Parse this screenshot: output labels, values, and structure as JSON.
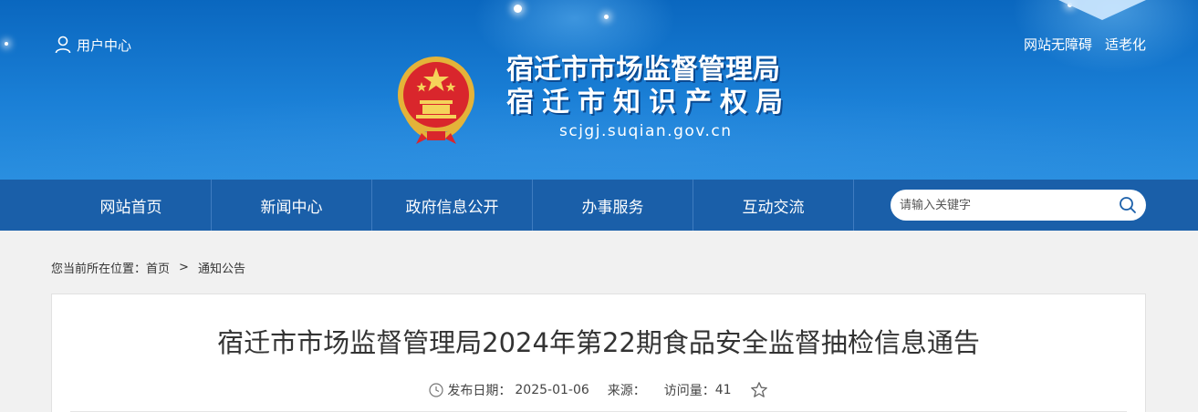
{
  "header": {
    "user_center": "用户中心",
    "accessibility": "网站无障碍",
    "elderly_mode": "适老化",
    "title_line1": "宿迁市市场监督管理局",
    "title_line2": "宿迁市知识产权局",
    "url": "scjgj.suqian.gov.cn",
    "emblem_icon": "national-emblem-icon"
  },
  "nav": {
    "items": [
      {
        "label": "网站首页"
      },
      {
        "label": "新闻中心"
      },
      {
        "label": "政府信息公开"
      },
      {
        "label": "办事服务"
      },
      {
        "label": "互动交流"
      }
    ]
  },
  "search": {
    "placeholder": "请输入关键字",
    "icon": "search-icon"
  },
  "breadcrumb": {
    "prefix": "您当前所在位置：",
    "home": "首页",
    "separator": ">",
    "current": "通知公告"
  },
  "article": {
    "title": "宿迁市市场监督管理局2024年第22期食品安全监督抽检信息通告",
    "publish_label": "发布日期：",
    "publish_date": "2025-01-06",
    "source_label": "来源：",
    "source": "",
    "visits_label": "访问量：",
    "visits": "41",
    "favorite_icon": "star-icon"
  },
  "colors": {
    "banner_blue": "#1a7fd6",
    "nav_blue": "#1a5fa9",
    "page_bg": "#f1f1f1"
  }
}
